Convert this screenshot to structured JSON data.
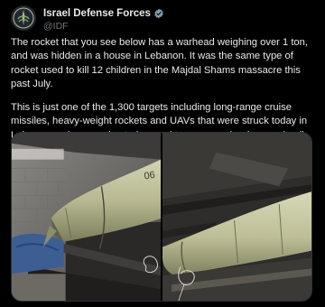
{
  "post": {
    "author": {
      "display_name": "Israel Defense Forces",
      "handle": "@IDF",
      "verified_icon": "verified-badge-icon",
      "verified_color": "#829aab",
      "avatar_icon": "idf-emblem-icon"
    },
    "paragraphs": [
      "The rocket that you see below has a warhead weighing over 1 ton, and was hidden in a house in Lebanon. It was the same type of rocket used to kill 12 children in the Majdal Shams massacre this past July.",
      "This is just one of the 1,300 targets including long-range cruise missiles, heavy-weight rockets and UAVs that were struck today in Lebanon and were going to be used to cause major damage in all areas of Israel."
    ],
    "media": {
      "photos": [
        {
          "rocket_marking": "06"
        },
        {
          "rocket_marking": ""
        }
      ]
    }
  },
  "colors": {
    "background": "#000000",
    "text_primary": "#e7e9ea",
    "text_secondary": "#71767b",
    "border": "#2f3336"
  }
}
